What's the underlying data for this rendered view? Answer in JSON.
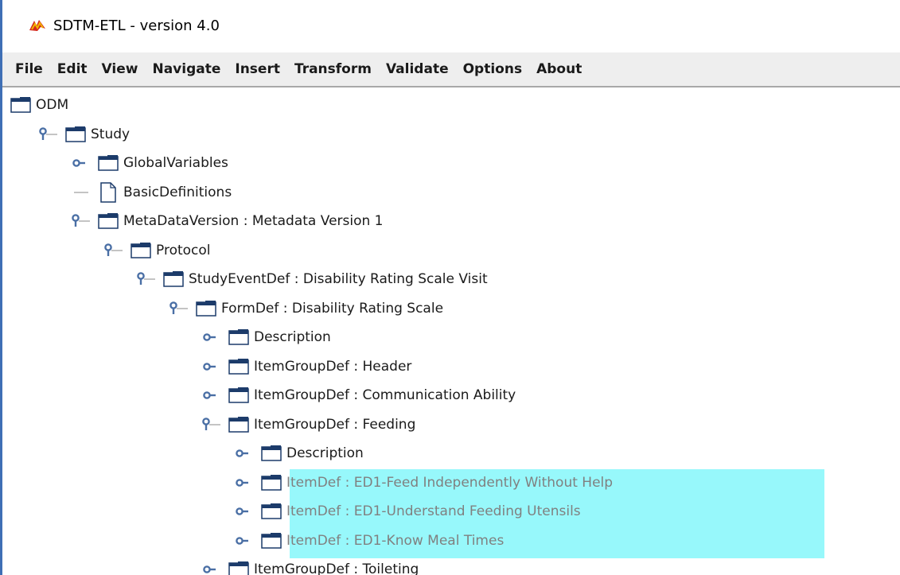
{
  "window": {
    "title": "SDTM-ETL - version 4.0"
  },
  "menu": [
    "File",
    "Edit",
    "View",
    "Navigate",
    "Insert",
    "Transform",
    "Validate",
    "Options",
    "About"
  ],
  "tree": [
    {
      "label": "ODM",
      "depth": 0,
      "handle": "none",
      "icon": "folder",
      "selected": false
    },
    {
      "label": "Study",
      "depth": 1,
      "handle": "expanded",
      "icon": "folder",
      "selected": false
    },
    {
      "label": "GlobalVariables",
      "depth": 2,
      "handle": "collapsed",
      "icon": "folder",
      "selected": false
    },
    {
      "label": "BasicDefinitions",
      "depth": 2,
      "handle": "leaf",
      "icon": "document",
      "selected": false
    },
    {
      "label": "MetaDataVersion : Metadata Version 1",
      "depth": 2,
      "handle": "expanded",
      "icon": "folder",
      "selected": false
    },
    {
      "label": "Protocol",
      "depth": 3,
      "handle": "expanded",
      "icon": "folder",
      "selected": false
    },
    {
      "label": "StudyEventDef : Disability Rating Scale Visit",
      "depth": 4,
      "handle": "expanded",
      "icon": "folder",
      "selected": false
    },
    {
      "label": "FormDef : Disability Rating Scale",
      "depth": 5,
      "handle": "expanded",
      "icon": "folder",
      "selected": false
    },
    {
      "label": "Description",
      "depth": 6,
      "handle": "collapsed",
      "icon": "folder",
      "selected": false
    },
    {
      "label": "ItemGroupDef : Header",
      "depth": 6,
      "handle": "collapsed",
      "icon": "folder",
      "selected": false
    },
    {
      "label": "ItemGroupDef : Communication Ability",
      "depth": 6,
      "handle": "collapsed",
      "icon": "folder",
      "selected": false
    },
    {
      "label": "ItemGroupDef : Feeding",
      "depth": 6,
      "handle": "expanded",
      "icon": "folder",
      "selected": false
    },
    {
      "label": "Description",
      "depth": 7,
      "handle": "collapsed",
      "icon": "folder",
      "selected": false
    },
    {
      "label": "ItemDef : ED1-Feed Independently Without Help",
      "depth": 7,
      "handle": "collapsed",
      "icon": "folder",
      "selected": true
    },
    {
      "label": "ItemDef : ED1-Understand Feeding Utensils",
      "depth": 7,
      "handle": "collapsed",
      "icon": "folder",
      "selected": true
    },
    {
      "label": "ItemDef : ED1-Know Meal Times",
      "depth": 7,
      "handle": "collapsed",
      "icon": "folder",
      "selected": true
    },
    {
      "label": "ItemGroupDef : Toileting",
      "depth": 6,
      "handle": "collapsed",
      "icon": "folder",
      "selected": false
    }
  ],
  "colors": {
    "selection": "#97f8fb",
    "handle": "#4a6fa5",
    "folder": "#1c3b6a"
  }
}
